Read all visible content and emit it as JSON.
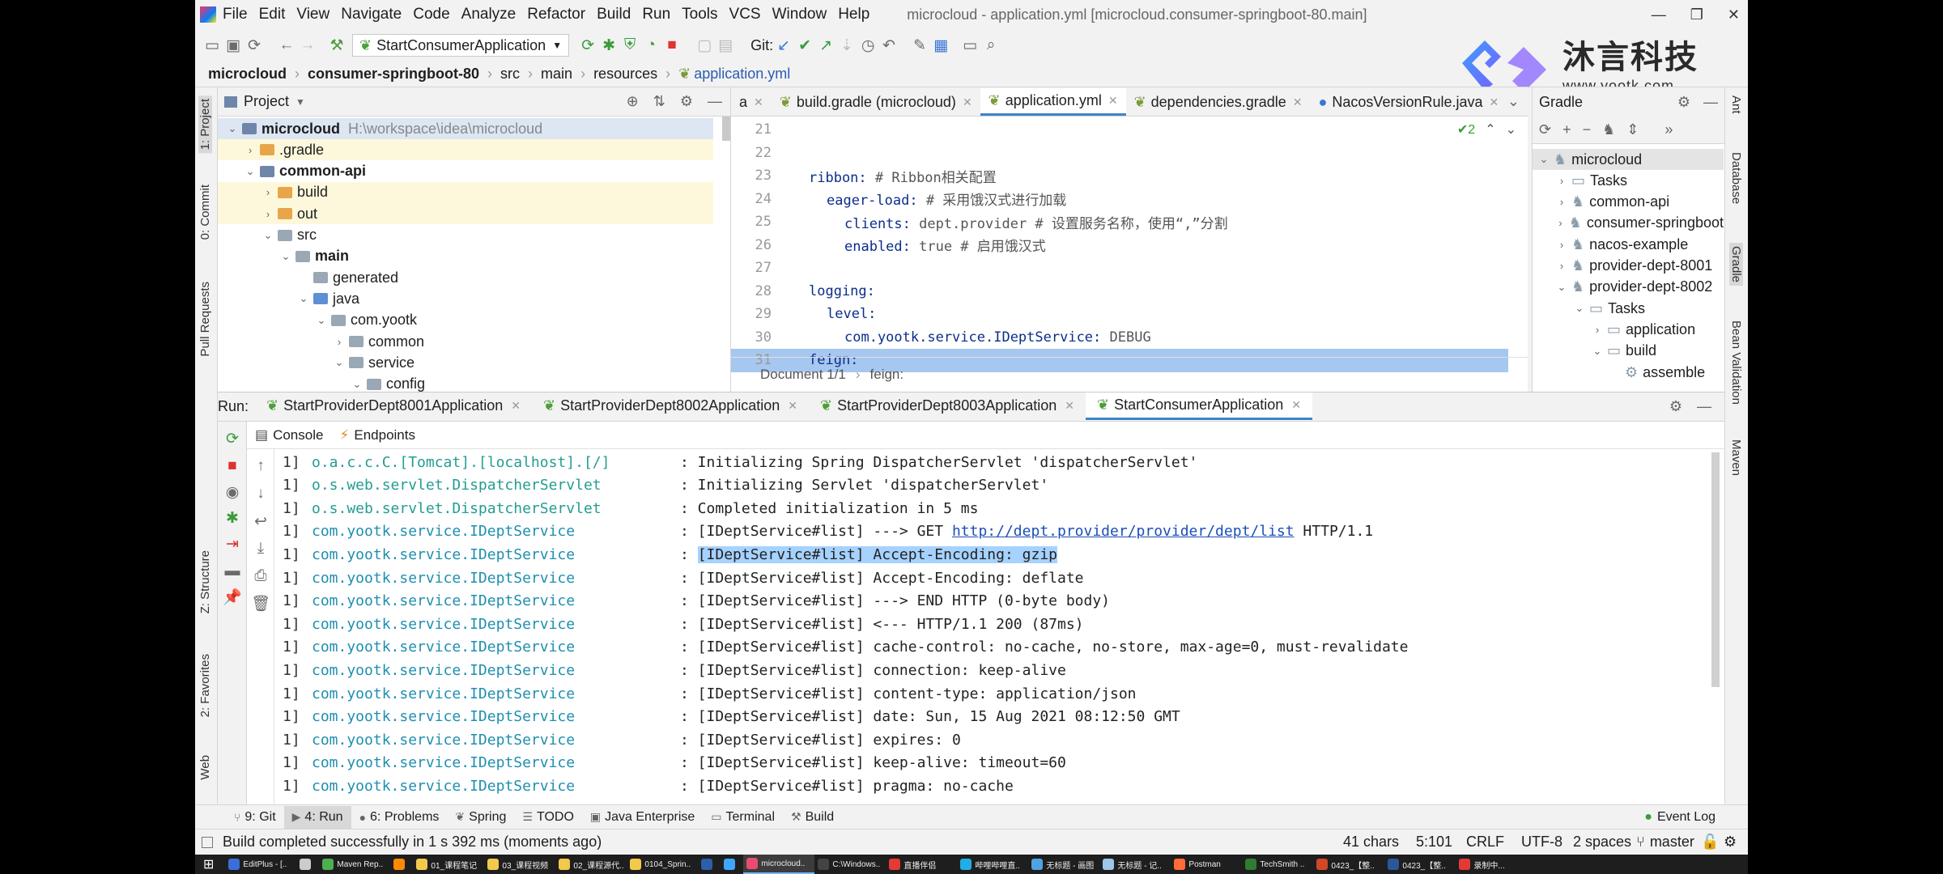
{
  "menu": [
    "File",
    "Edit",
    "View",
    "Navigate",
    "Code",
    "Analyze",
    "Refactor",
    "Build",
    "Run",
    "Tools",
    "VCS",
    "Window",
    "Help"
  ],
  "window_title": "microcloud - application.yml [microcloud.consumer-springboot-80.main]",
  "toolbar": {
    "run_config": "StartConsumerApplication",
    "git_label": "Git:"
  },
  "watermark": {
    "brand": "沐言科技",
    "url": "www.yootk.com"
  },
  "breadcrumb": [
    "microcloud",
    "consumer-springboot-80",
    "src",
    "main",
    "resources",
    "application.yml"
  ],
  "left_stripe": [
    "1: Project",
    "0: Commit",
    "Pull Requests",
    "Z: Structure",
    "2: Favorites",
    "Web"
  ],
  "right_stripe": [
    "Ant",
    "Database",
    "Gradle",
    "Bean Validation",
    "Maven"
  ],
  "project": {
    "title": "Project",
    "items": [
      {
        "label": "microcloud",
        "extra": "H:\\workspace\\idea\\microcloud",
        "depth": 0,
        "arrow": "v",
        "kind": "module",
        "bold": true
      },
      {
        "label": ".gradle",
        "depth": 1,
        "arrow": ">",
        "kind": "orange"
      },
      {
        "label": "common-api",
        "depth": 1,
        "arrow": "v",
        "kind": "module",
        "bold": true
      },
      {
        "label": "build",
        "depth": 2,
        "arrow": ">",
        "kind": "orange"
      },
      {
        "label": "out",
        "depth": 2,
        "arrow": ">",
        "kind": "orange"
      },
      {
        "label": "src",
        "depth": 2,
        "arrow": "v",
        "kind": "gray"
      },
      {
        "label": "main",
        "depth": 3,
        "arrow": "v",
        "kind": "gray",
        "bold": true
      },
      {
        "label": "generated",
        "depth": 4,
        "arrow": "",
        "kind": "gray"
      },
      {
        "label": "java",
        "depth": 4,
        "arrow": "v",
        "kind": "blue"
      },
      {
        "label": "com.yootk",
        "depth": 5,
        "arrow": "v",
        "kind": "gray"
      },
      {
        "label": "common",
        "depth": 6,
        "arrow": ">",
        "kind": "gray"
      },
      {
        "label": "service",
        "depth": 6,
        "arrow": "v",
        "kind": "gray"
      },
      {
        "label": "config",
        "depth": 7,
        "arrow": "v",
        "kind": "gray"
      }
    ]
  },
  "editor": {
    "tabs": [
      {
        "label": "a"
      },
      {
        "label": "build.gradle (microcloud)"
      },
      {
        "label": "application.yml",
        "active": true
      },
      {
        "label": "dependencies.gradle"
      },
      {
        "label": "NacosVersionRule.java"
      }
    ],
    "inspection_count": "2",
    "lines": [
      {
        "n": "21",
        "indent": 0,
        "key": "",
        "rest": ""
      },
      {
        "n": "22",
        "indent": 0,
        "key": "",
        "rest": ""
      },
      {
        "n": "23",
        "indent": 0,
        "key": "ribbon:",
        "rest": " # Ribbon相关配置"
      },
      {
        "n": "24",
        "indent": 1,
        "key": "eager-load:",
        "rest": " # 采用饿汉式进行加载"
      },
      {
        "n": "25",
        "indent": 2,
        "key": "clients:",
        "rest": " dept.provider # 设置服务名称，使用“,”分割"
      },
      {
        "n": "26",
        "indent": 2,
        "key": "enabled:",
        "rest": " true # 启用饿汉式"
      },
      {
        "n": "27",
        "indent": 0,
        "key": "",
        "rest": ""
      },
      {
        "n": "28",
        "indent": 0,
        "key": "logging:",
        "rest": ""
      },
      {
        "n": "29",
        "indent": 1,
        "key": "level:",
        "rest": ""
      },
      {
        "n": "30",
        "indent": 2,
        "key": "com.yootk.service.IDeptService:",
        "rest": " DEBUG"
      },
      {
        "n": "31",
        "indent": 0,
        "key": "feign:",
        "rest": ""
      }
    ],
    "status_path": [
      "Document 1/1",
      "feign:"
    ]
  },
  "gradle": {
    "title": "Gradle",
    "items": [
      {
        "label": "microcloud",
        "depth": 0,
        "arrow": "v"
      },
      {
        "label": "Tasks",
        "depth": 1,
        "arrow": ">",
        "kind": "folder"
      },
      {
        "label": "common-api",
        "depth": 1,
        "arrow": ">"
      },
      {
        "label": "consumer-springboot",
        "depth": 1,
        "arrow": ">"
      },
      {
        "label": "nacos-example",
        "depth": 1,
        "arrow": ">"
      },
      {
        "label": "provider-dept-8001",
        "depth": 1,
        "arrow": ">"
      },
      {
        "label": "provider-dept-8002",
        "depth": 1,
        "arrow": "v"
      },
      {
        "label": "Tasks",
        "depth": 2,
        "arrow": "v",
        "kind": "folder"
      },
      {
        "label": "application",
        "depth": 3,
        "arrow": ">",
        "kind": "folder"
      },
      {
        "label": "build",
        "depth": 3,
        "arrow": "v",
        "kind": "folder"
      },
      {
        "label": "assemble",
        "depth": 4,
        "arrow": "",
        "kind": "gear"
      }
    ]
  },
  "run": {
    "label": "Run:",
    "tabs": [
      {
        "label": "StartProviderDept8001Application"
      },
      {
        "label": "StartProviderDept8002Application"
      },
      {
        "label": "StartProviderDept8003Application"
      },
      {
        "label": "StartConsumerApplication",
        "active": true
      }
    ],
    "subtabs": [
      "Console",
      "Endpoints"
    ],
    "console": [
      {
        "p": "1]",
        "logger": "o.a.c.c.C.[Tomcat].[localhost].[/]",
        "c": "#239d92",
        "msg": ": Initializing Spring DispatcherServlet 'dispatcherServlet'"
      },
      {
        "p": "1]",
        "logger": "o.s.web.servlet.DispatcherServlet",
        "c": "#239d92",
        "msg": ": Initializing Servlet 'dispatcherServlet'"
      },
      {
        "p": "1]",
        "logger": "o.s.web.servlet.DispatcherServlet",
        "c": "#239d92",
        "msg": ": Completed initialization in 5 ms"
      },
      {
        "p": "1]",
        "logger": "com.yootk.service.IDeptService",
        "c": "#1f8fb0",
        "msg": ": [IDeptService#list] ---> GET ",
        "link": "http://dept.provider/provider/dept/list",
        "after": " HTTP/1.1"
      },
      {
        "p": "1]",
        "logger": "com.yootk.service.IDeptService",
        "c": "#1f8fb0",
        "msg": ": ",
        "hl": "[IDeptService#list] Accept-Encoding: gzip"
      },
      {
        "p": "1]",
        "logger": "com.yootk.service.IDeptService",
        "c": "#1f8fb0",
        "msg": ": [IDeptService#list] Accept-Encoding: deflate"
      },
      {
        "p": "1]",
        "logger": "com.yootk.service.IDeptService",
        "c": "#1f8fb0",
        "msg": ": [IDeptService#list] ---> END HTTP (0-byte body)"
      },
      {
        "p": "1]",
        "logger": "com.yootk.service.IDeptService",
        "c": "#1f8fb0",
        "msg": ": [IDeptService#list] <--- HTTP/1.1 200  (87ms)"
      },
      {
        "p": "1]",
        "logger": "com.yootk.service.IDeptService",
        "c": "#1f8fb0",
        "msg": ": [IDeptService#list] cache-control: no-cache, no-store, max-age=0, must-revalidate"
      },
      {
        "p": "1]",
        "logger": "com.yootk.service.IDeptService",
        "c": "#1f8fb0",
        "msg": ": [IDeptService#list] connection: keep-alive"
      },
      {
        "p": "1]",
        "logger": "com.yootk.service.IDeptService",
        "c": "#1f8fb0",
        "msg": ": [IDeptService#list] content-type: application/json"
      },
      {
        "p": "1]",
        "logger": "com.yootk.service.IDeptService",
        "c": "#1f8fb0",
        "msg": ": [IDeptService#list] date: Sun, 15 Aug 2021 08:12:50 GMT"
      },
      {
        "p": "1]",
        "logger": "com.yootk.service.IDeptService",
        "c": "#1f8fb0",
        "msg": ": [IDeptService#list] expires: 0"
      },
      {
        "p": "1]",
        "logger": "com.yootk.service.IDeptService",
        "c": "#1f8fb0",
        "msg": ": [IDeptService#list] keep-alive: timeout=60"
      },
      {
        "p": "1]",
        "logger": "com.yootk.service.IDeptService",
        "c": "#1f8fb0",
        "msg": ": [IDeptService#list] pragma: no-cache"
      }
    ]
  },
  "bottom_tools": [
    {
      "label": "9: Git",
      "icon": "⑂"
    },
    {
      "label": "4: Run",
      "icon": "▶",
      "active": true
    },
    {
      "label": "6: Problems",
      "icon": "●"
    },
    {
      "label": "Spring",
      "icon": "❦"
    },
    {
      "label": "TODO",
      "icon": "☰"
    },
    {
      "label": "Java Enterprise",
      "icon": "▣"
    },
    {
      "label": "Terminal",
      "icon": "▭"
    },
    {
      "label": "Build",
      "icon": "⚒"
    }
  ],
  "event_log": "Event Log",
  "status": {
    "message": "Build completed successfully in 1 s 392 ms (moments ago)",
    "chars": "41 chars",
    "pos": "5:101",
    "eol": "CRLF",
    "encoding": "UTF-8",
    "indent": "2 spaces",
    "branch": "master"
  },
  "taskbar": [
    {
      "label": "EditPlus - [..",
      "color": "#3a6fd8"
    },
    {
      "label": "",
      "color": "#ccc"
    },
    {
      "label": "Maven Rep..",
      "color": "#4caf50"
    },
    {
      "label": "",
      "color": "#ff8a00"
    },
    {
      "label": "01_课程笔记",
      "color": "#f2c94c"
    },
    {
      "label": "03_课程视频",
      "color": "#f2c94c"
    },
    {
      "label": "02_课程源代..",
      "color": "#f2c94c"
    },
    {
      "label": "0104_Sprin..",
      "color": "#f2c94c"
    },
    {
      "label": "",
      "color": "#2b5fa8"
    },
    {
      "label": "",
      "color": "#3ea6ff"
    },
    {
      "label": "microcloud..",
      "color": "#e94c6f",
      "active": true
    },
    {
      "label": "C:\\Windows..",
      "color": "#444"
    },
    {
      "label": "直播伴侣",
      "color": "#e53935"
    },
    {
      "label": "哔哩哔哩直..",
      "color": "#23ade5"
    },
    {
      "label": "无标题 - 画图",
      "color": "#4fa3e0"
    },
    {
      "label": "无标题 - 记..",
      "color": "#9fc5e8"
    },
    {
      "label": "Postman",
      "color": "#ff6c37"
    },
    {
      "label": "TechSmith ..",
      "color": "#2e7d32"
    },
    {
      "label": "0423_【整..",
      "color": "#d24726"
    },
    {
      "label": "0423_【整..",
      "color": "#2b579a"
    },
    {
      "label": "录制中...",
      "color": "#e53935"
    }
  ]
}
